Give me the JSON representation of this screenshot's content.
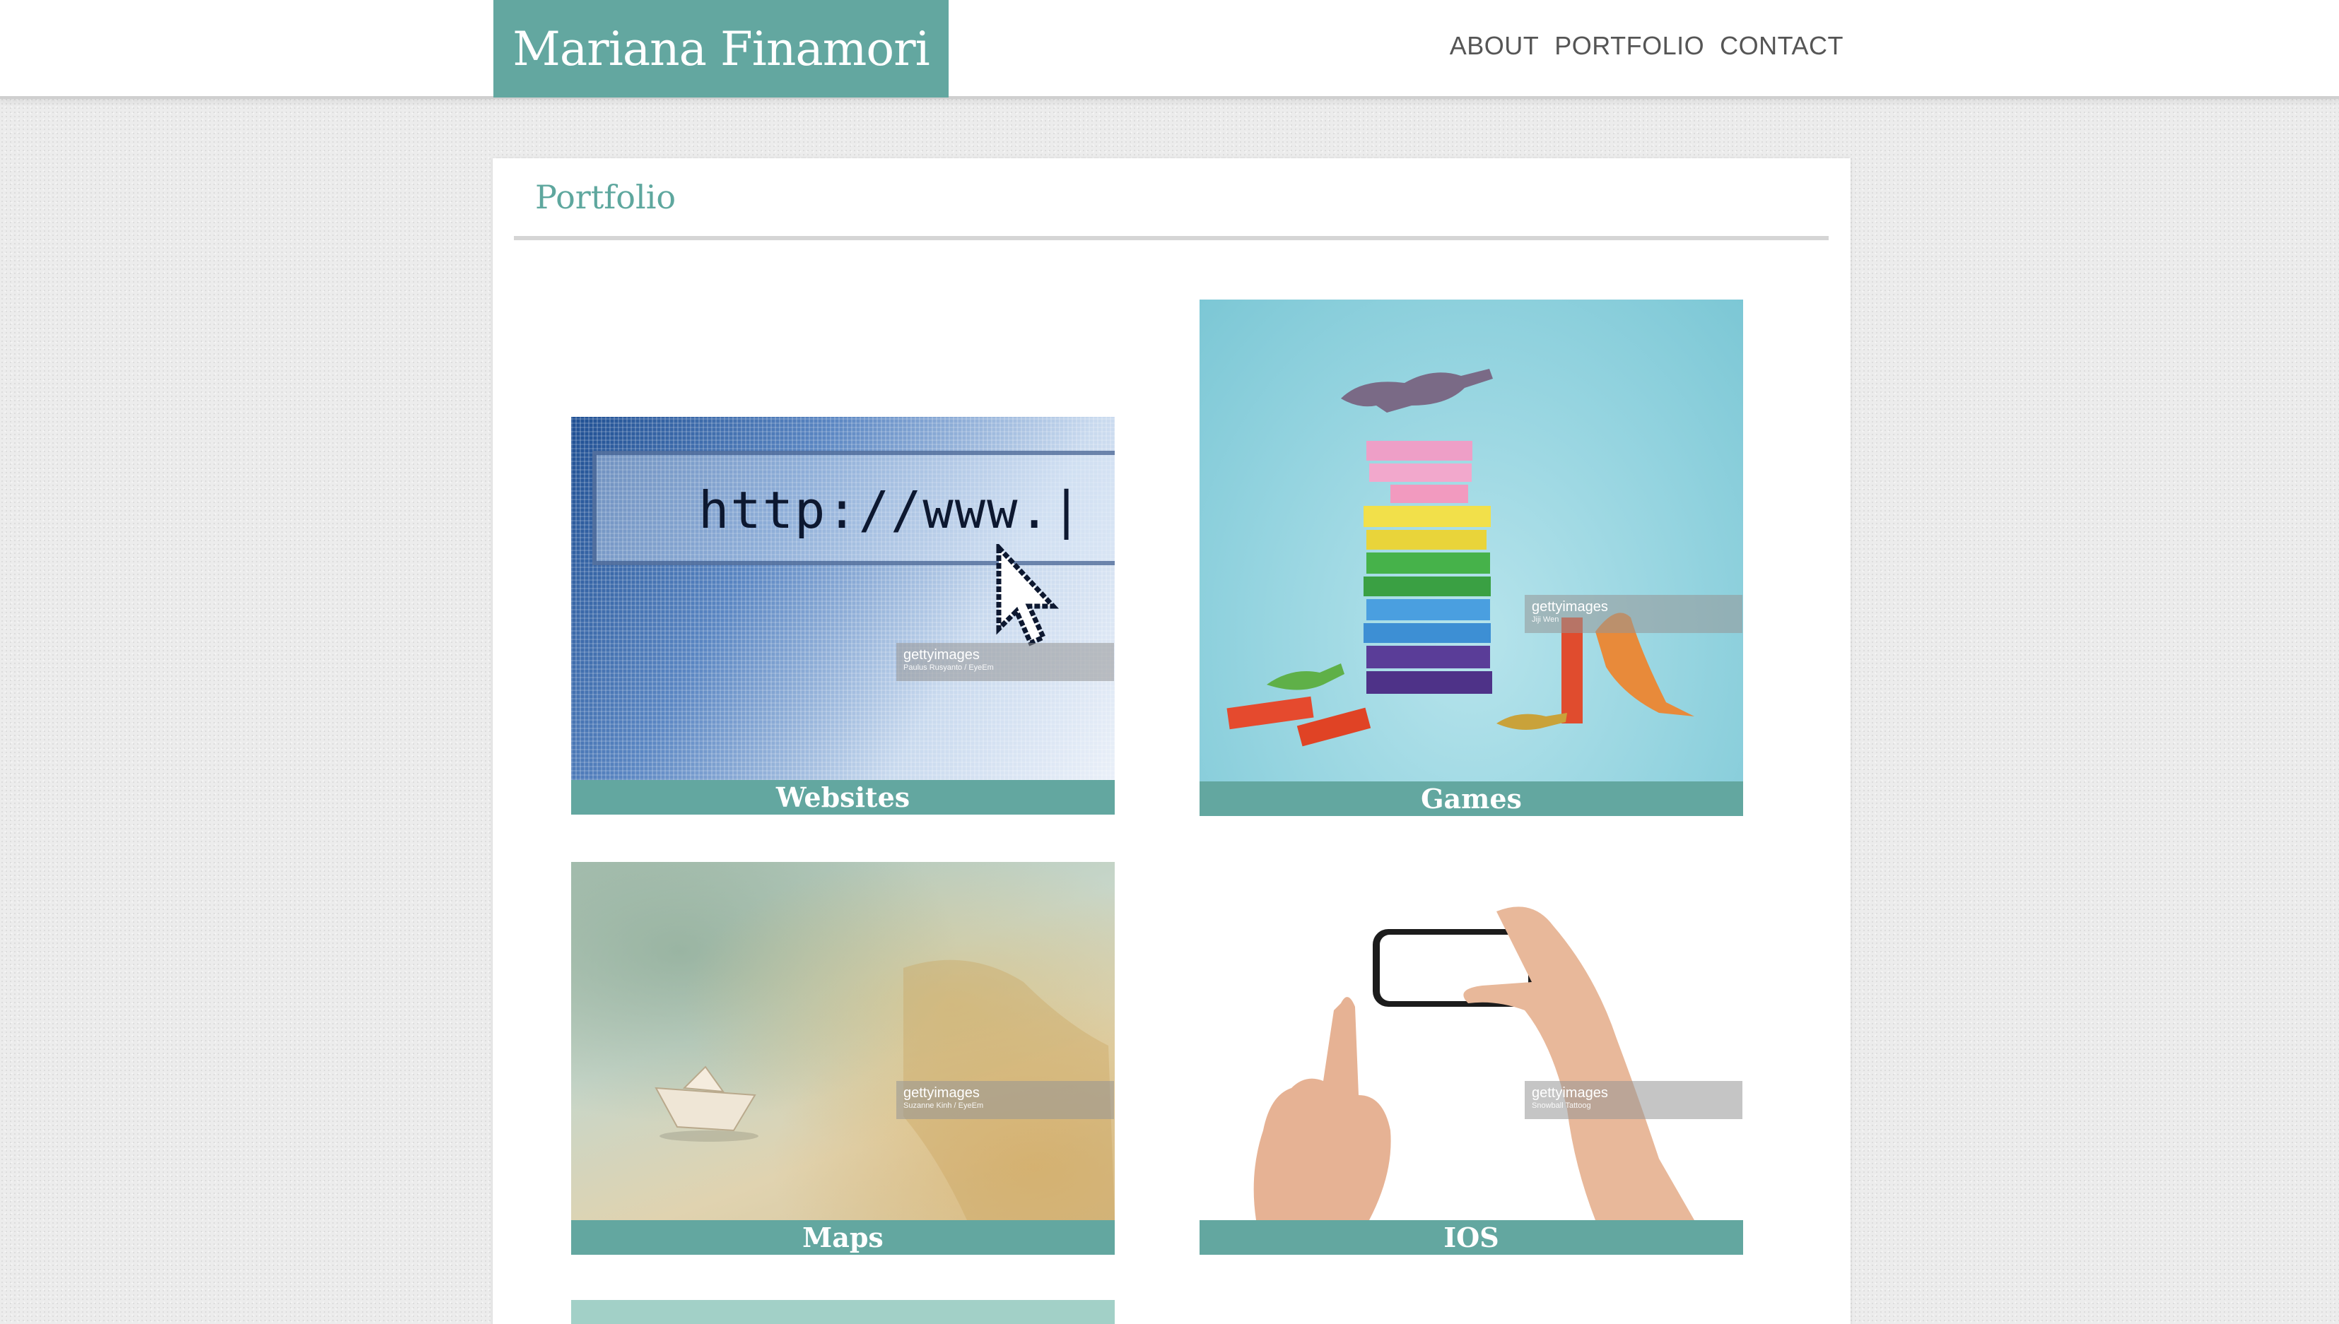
{
  "header": {
    "brand": "Mariana Finamori",
    "nav": [
      "ABOUT",
      "PORTFOLIO",
      "CONTACT"
    ]
  },
  "main": {
    "title": "Portfolio",
    "tiles": [
      {
        "label": "Websites",
        "image": "url-bar-with-cursor",
        "credit": "gettyimages",
        "credit_sub": "Paulus Rusyanto / EyeEm"
      },
      {
        "label": "Games",
        "image": "dinosaurs-on-block-tower",
        "credit": "gettyimages",
        "credit_sub": "Jiji Wen"
      },
      {
        "label": "Maps",
        "image": "paper-boat-on-map",
        "credit": "gettyimages",
        "credit_sub": "Suzanne Kinh / EyeEm"
      },
      {
        "label": "IOS",
        "image": "hands-holding-phone",
        "credit": "gettyimages",
        "credit_sub": "Snowball Tattoog"
      }
    ]
  },
  "colors": {
    "accent": "#63a7a0",
    "title": "#5ea79e",
    "nav_text": "#555555"
  }
}
